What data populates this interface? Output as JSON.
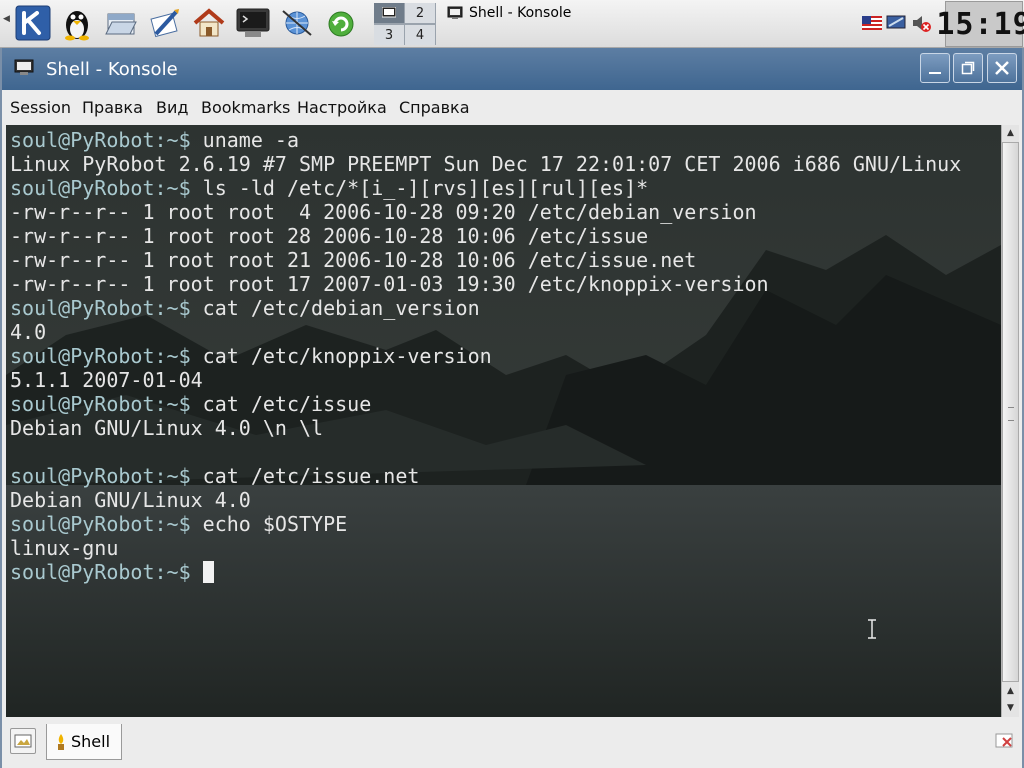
{
  "taskbar": {
    "launchers": [
      "kde-menu-icon",
      "tux-icon",
      "file-manager-icon",
      "office-icon",
      "home-icon",
      "terminal-icon",
      "network-icon",
      "update-icon"
    ],
    "pager": [
      "1",
      "2",
      "3",
      "4"
    ],
    "task_title": "Shell - Konsole",
    "clock": "15:19",
    "tray_icons": [
      "us-flag-icon",
      "screen-icon",
      "speaker-muted-icon"
    ]
  },
  "window": {
    "title": "Shell - Konsole",
    "menu": [
      "Session",
      "Правка",
      "Вид",
      "Bookmarks",
      "Настройка",
      "Справка"
    ]
  },
  "terminal": {
    "prompt": "soul@PyRobot:~$",
    "lines": [
      {
        "prompt": "soul@PyRobot:~$",
        "text": " uname -a"
      },
      {
        "prompt": "",
        "text": "Linux PyRobot 2.6.19 #7 SMP PREEMPT Sun Dec 17 22:01:07 CET 2006 i686 GNU/Linux"
      },
      {
        "prompt": "soul@PyRobot:~$",
        "text": " ls -ld /etc/*[i_-][rvs][es][rul][es]*"
      },
      {
        "prompt": "",
        "text": "-rw-r--r-- 1 root root  4 2006-10-28 09:20 /etc/debian_version"
      },
      {
        "prompt": "",
        "text": "-rw-r--r-- 1 root root 28 2006-10-28 10:06 /etc/issue"
      },
      {
        "prompt": "",
        "text": "-rw-r--r-- 1 root root 21 2006-10-28 10:06 /etc/issue.net"
      },
      {
        "prompt": "",
        "text": "-rw-r--r-- 1 root root 17 2007-01-03 19:30 /etc/knoppix-version"
      },
      {
        "prompt": "soul@PyRobot:~$",
        "text": " cat /etc/debian_version"
      },
      {
        "prompt": "",
        "text": "4.0"
      },
      {
        "prompt": "soul@PyRobot:~$",
        "text": " cat /etc/knoppix-version"
      },
      {
        "prompt": "",
        "text": "5.1.1 2007-01-04"
      },
      {
        "prompt": "soul@PyRobot:~$",
        "text": " cat /etc/issue"
      },
      {
        "prompt": "",
        "text": "Debian GNU/Linux 4.0 \\n \\l"
      },
      {
        "prompt": "",
        "text": ""
      },
      {
        "prompt": "soul@PyRobot:~$",
        "text": " cat /etc/issue.net"
      },
      {
        "prompt": "",
        "text": "Debian GNU/Linux 4.0"
      },
      {
        "prompt": "soul@PyRobot:~$",
        "text": " echo $OSTYPE"
      },
      {
        "prompt": "",
        "text": "linux-gnu"
      },
      {
        "prompt": "soul@PyRobot:~$",
        "text": " "
      }
    ]
  },
  "tabs": {
    "items": [
      {
        "label": "Shell",
        "icon": "shell-tab-icon"
      }
    ],
    "new_tab_icon": "new-session-icon",
    "close_tab_icon": "close-session-icon"
  },
  "colors": {
    "titlebar": "#4a7099",
    "terminal_bg": "#262b29",
    "terminal_fg": "#e6e6e6",
    "prompt": "#a9c9cf"
  }
}
